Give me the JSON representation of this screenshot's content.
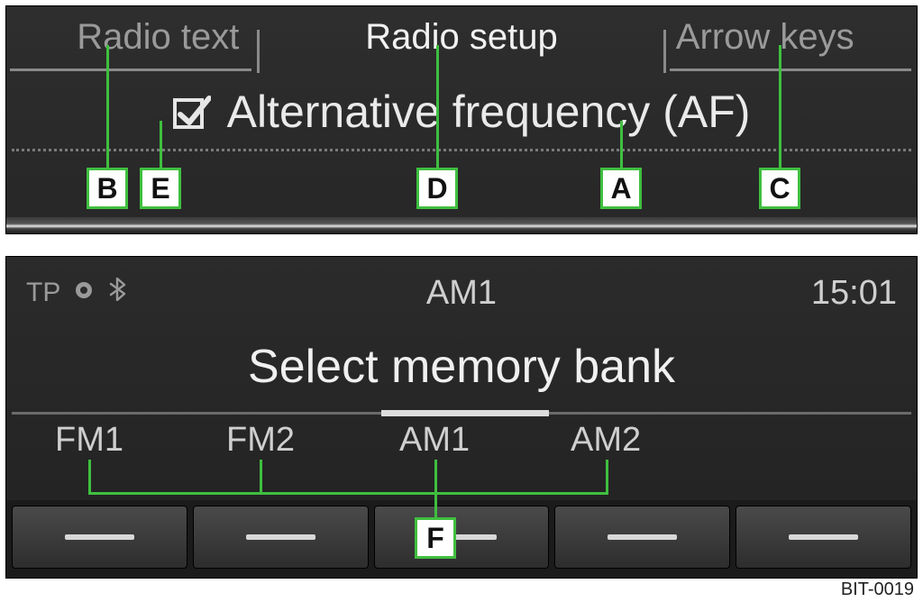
{
  "tabs": {
    "left": "Radio text",
    "center": "Radio setup",
    "right": "Arrow keys"
  },
  "option": "Alternative frequency (AF)",
  "callouts": {
    "A": "A",
    "B": "B",
    "C": "C",
    "D": "D",
    "E": "E",
    "F": "F"
  },
  "status": {
    "tp": "TP",
    "band": "AM1",
    "clock": "15:01"
  },
  "title": "Select memory bank",
  "banks": [
    "FM1",
    "FM2",
    "AM1",
    "AM2"
  ],
  "figure_id": "BIT-0019"
}
